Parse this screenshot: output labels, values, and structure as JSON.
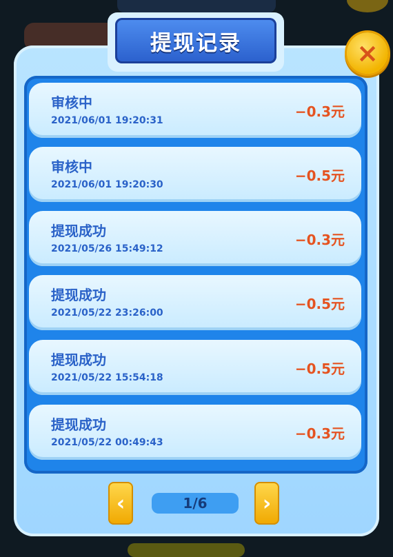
{
  "dialog": {
    "title": "提现记录",
    "close_icon": "×"
  },
  "records": [
    {
      "status": "审核中",
      "time": "2021/06/01 19:20:31",
      "amount": "−0.3元"
    },
    {
      "status": "审核中",
      "time": "2021/06/01 19:20:30",
      "amount": "−0.5元"
    },
    {
      "status": "提现成功",
      "time": "2021/05/26 15:49:12",
      "amount": "−0.3元"
    },
    {
      "status": "提现成功",
      "time": "2021/05/22 23:26:00",
      "amount": "−0.5元"
    },
    {
      "status": "提现成功",
      "time": "2021/05/22 15:54:18",
      "amount": "−0.5元"
    },
    {
      "status": "提现成功",
      "time": "2021/05/22 00:49:43",
      "amount": "−0.3元"
    }
  ],
  "pager": {
    "prev_icon": "‹",
    "next_icon": "›",
    "indicator": "1/6"
  },
  "colors": {
    "accent_blue": "#2a62c8",
    "amount_orange": "#e55320",
    "panel_blue": "#1f84ea",
    "button_yellow": "#f2b400"
  }
}
